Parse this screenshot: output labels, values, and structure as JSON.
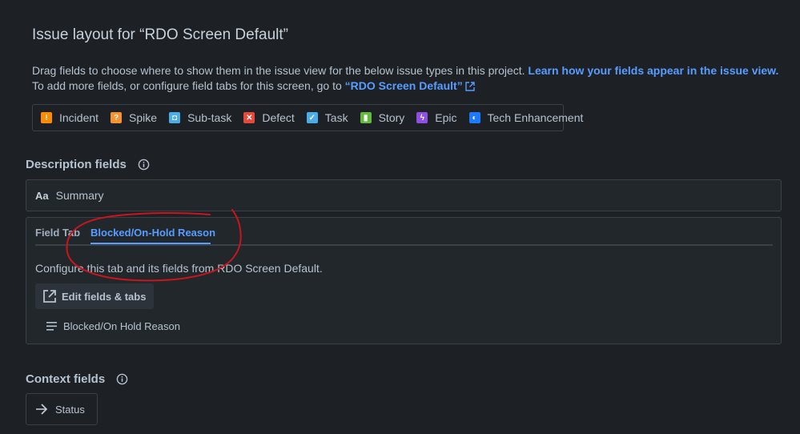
{
  "page": {
    "title": "Issue layout for “RDO Screen Default”",
    "desc_line1": "Drag fields to choose where to show them in the issue view for the below issue types in this project. ",
    "desc_link1": "Learn how your fields appear in the issue view.",
    "desc_line2": "To add more fields, or configure field tabs for this screen, go to ",
    "desc_link2": "“RDO Screen Default”"
  },
  "issue_types": [
    {
      "label": "Incident",
      "icon": "incident-icon",
      "color": "#ff8b00",
      "glyph": "!"
    },
    {
      "label": "Spike",
      "icon": "spike-icon",
      "color": "#f79232",
      "glyph": "?"
    },
    {
      "label": "Sub-task",
      "icon": "subtask-icon",
      "color": "#4bade8",
      "glyph": "◘"
    },
    {
      "label": "Defect",
      "icon": "defect-icon",
      "color": "#e5493a",
      "glyph": "✕"
    },
    {
      "label": "Task",
      "icon": "task-icon",
      "color": "#4bade8",
      "glyph": "✓"
    },
    {
      "label": "Story",
      "icon": "story-icon",
      "color": "#63ba3c",
      "glyph": "▮"
    },
    {
      "label": "Epic",
      "icon": "epic-icon",
      "color": "#904ee2",
      "glyph": "ϟ"
    },
    {
      "label": "Tech Enhancement",
      "icon": "tech-enhancement-icon",
      "color": "#1d7afc",
      "glyph": "◐"
    }
  ],
  "description_fields": {
    "title": "Description fields",
    "summary_glyph": "Aa",
    "summary_label": "Summary"
  },
  "tabs": {
    "items": [
      "Field Tab",
      "Blocked/On-Hold Reason"
    ],
    "active": "Blocked/On-Hold Reason",
    "config_text": "Configure this tab and its fields from RDO Screen Default.",
    "edit_button": "Edit fields & tabs",
    "field": "Blocked/On Hold Reason"
  },
  "context_fields": {
    "title": "Context fields",
    "status_label": "Status"
  },
  "colors": {
    "background": "#1d2125",
    "link": "#579dff",
    "annotation": "#c9151e"
  }
}
